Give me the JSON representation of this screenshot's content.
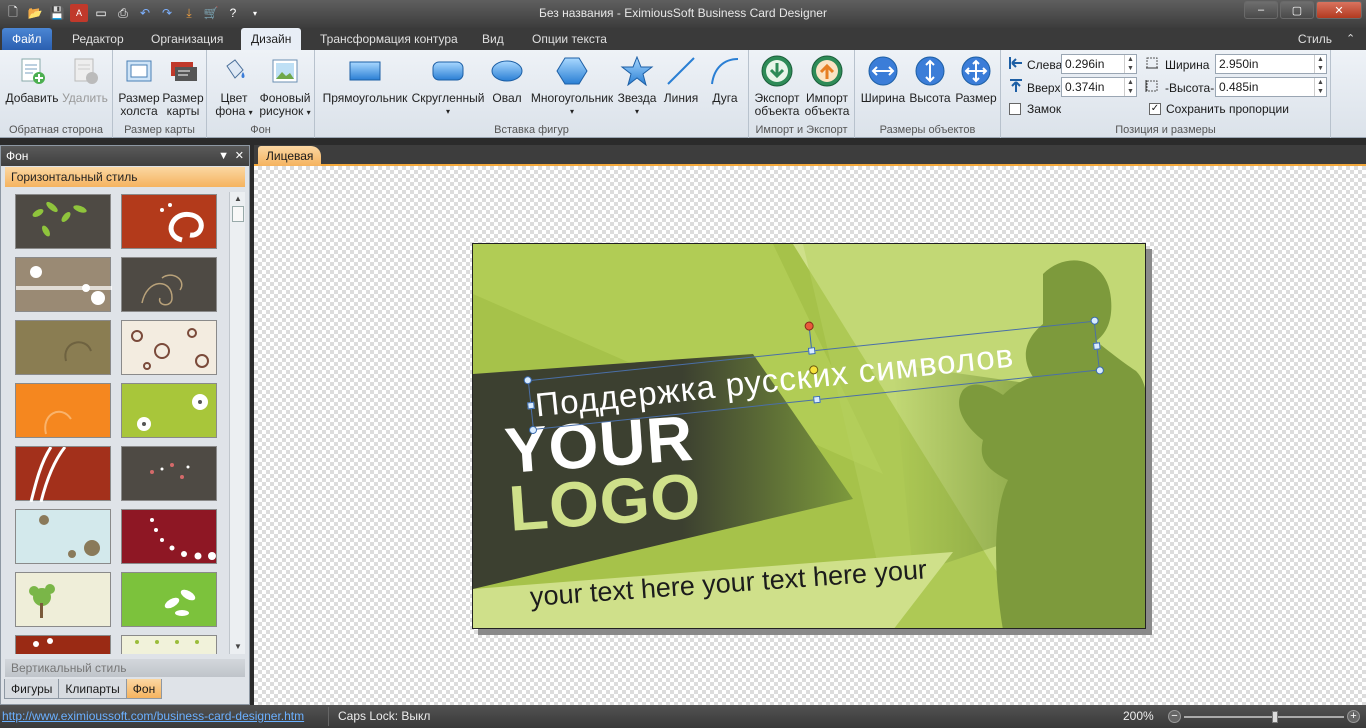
{
  "window": {
    "title": "Без названия - EximiousSoft Business Card Designer",
    "controls": [
      "–",
      "▢",
      "✕"
    ]
  },
  "menu": {
    "tabs": [
      "Файл",
      "Редактор",
      "Организация",
      "Дизайн",
      "Трансформация контура",
      "Вид",
      "Опции текста"
    ],
    "active_tab": "Дизайн",
    "style_label": "Стиль"
  },
  "ribbon": {
    "groups": {
      "back": {
        "label": "Обратная сторона",
        "add": "Добавить",
        "remove": "Удалить"
      },
      "cardsize": {
        "label": "Размер карты",
        "canvas_size": [
          "Размер",
          "холста"
        ],
        "card_size": [
          "Размер",
          "карты"
        ]
      },
      "background": {
        "label": "Фон",
        "bg_color": [
          "Цвет",
          "фона"
        ],
        "bg_image": [
          "Фоновый",
          "рисунок"
        ]
      },
      "shapes": {
        "label": "Вставка фигур",
        "items": [
          "Прямоугольник",
          "Скругленный",
          "Овал",
          "Многоугольник",
          "Звезда",
          "Линия",
          "Дуга"
        ]
      },
      "importexport": {
        "label": "Импорт и Экспорт",
        "export": [
          "Экспорт",
          "объекта"
        ],
        "import": [
          "Импорт",
          "объекта"
        ]
      },
      "objsize": {
        "label": "Размеры объектов",
        "items": [
          "Ширина",
          "Высота",
          "Размер"
        ]
      },
      "position": {
        "label": "Позиция и размеры",
        "left_label": "Слева",
        "left_value": "0.296in",
        "top_label": "Вверх",
        "top_value": "0.374in",
        "width_label": "Ширина",
        "width_value": "2.950in",
        "height_label": "-Высота-",
        "height_value": "0.485in",
        "lock_label": "Замок",
        "lock_checked": false,
        "keep_ratio_label": "Сохранить пропорции",
        "keep_ratio_checked": true
      }
    }
  },
  "panel": {
    "title": "Фон",
    "section_horizontal": "Горизонтальный стиль",
    "section_vertical": "Вертикальный стиль",
    "tabs": [
      "Фигуры",
      "Клипарты",
      "Фон"
    ],
    "active_tab": "Фон"
  },
  "document": {
    "tab": "Лицевая",
    "card": {
      "headline": "Поддержка русских символов",
      "logo_line1": "YOUR",
      "logo_line2": "LOGO",
      "tagline": "your text here your text here your"
    }
  },
  "status": {
    "link": "http://www.eximioussoft.com/business-card-designer.htm",
    "caps": "Caps Lock: Выкл",
    "zoom": "200%"
  },
  "colors": {
    "card_light": "#cfe08a",
    "card_mid": "#a6c24a",
    "card_dark": "#3c4030",
    "silhouette": "#7d9a3c",
    "accent_orange": "#f5b35f"
  }
}
